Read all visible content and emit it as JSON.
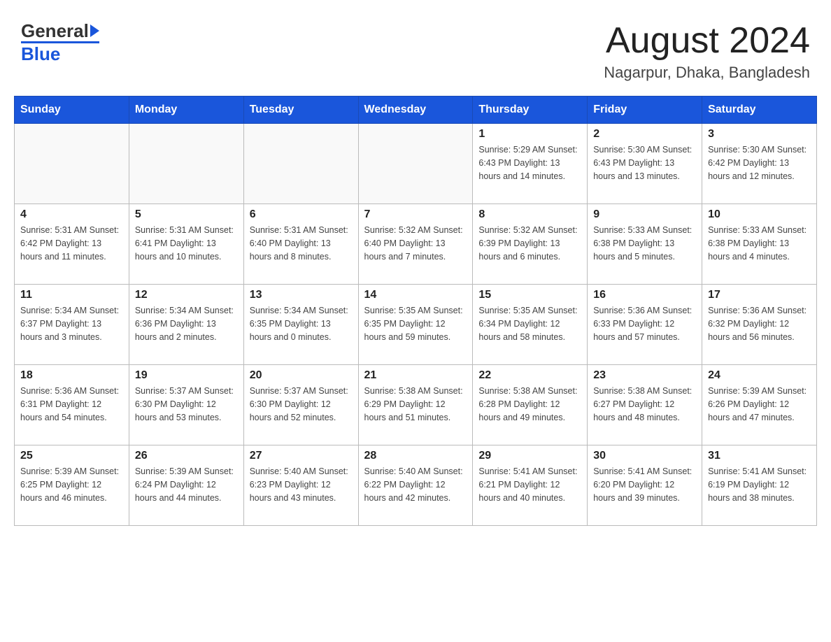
{
  "header": {
    "logo_general": "General",
    "logo_blue": "Blue",
    "month_title": "August 2024",
    "location": "Nagarpur, Dhaka, Bangladesh"
  },
  "days_of_week": [
    "Sunday",
    "Monday",
    "Tuesday",
    "Wednesday",
    "Thursday",
    "Friday",
    "Saturday"
  ],
  "weeks": [
    [
      {
        "day": "",
        "info": ""
      },
      {
        "day": "",
        "info": ""
      },
      {
        "day": "",
        "info": ""
      },
      {
        "day": "",
        "info": ""
      },
      {
        "day": "1",
        "info": "Sunrise: 5:29 AM\nSunset: 6:43 PM\nDaylight: 13 hours\nand 14 minutes."
      },
      {
        "day": "2",
        "info": "Sunrise: 5:30 AM\nSunset: 6:43 PM\nDaylight: 13 hours\nand 13 minutes."
      },
      {
        "day": "3",
        "info": "Sunrise: 5:30 AM\nSunset: 6:42 PM\nDaylight: 13 hours\nand 12 minutes."
      }
    ],
    [
      {
        "day": "4",
        "info": "Sunrise: 5:31 AM\nSunset: 6:42 PM\nDaylight: 13 hours\nand 11 minutes."
      },
      {
        "day": "5",
        "info": "Sunrise: 5:31 AM\nSunset: 6:41 PM\nDaylight: 13 hours\nand 10 minutes."
      },
      {
        "day": "6",
        "info": "Sunrise: 5:31 AM\nSunset: 6:40 PM\nDaylight: 13 hours\nand 8 minutes."
      },
      {
        "day": "7",
        "info": "Sunrise: 5:32 AM\nSunset: 6:40 PM\nDaylight: 13 hours\nand 7 minutes."
      },
      {
        "day": "8",
        "info": "Sunrise: 5:32 AM\nSunset: 6:39 PM\nDaylight: 13 hours\nand 6 minutes."
      },
      {
        "day": "9",
        "info": "Sunrise: 5:33 AM\nSunset: 6:38 PM\nDaylight: 13 hours\nand 5 minutes."
      },
      {
        "day": "10",
        "info": "Sunrise: 5:33 AM\nSunset: 6:38 PM\nDaylight: 13 hours\nand 4 minutes."
      }
    ],
    [
      {
        "day": "11",
        "info": "Sunrise: 5:34 AM\nSunset: 6:37 PM\nDaylight: 13 hours\nand 3 minutes."
      },
      {
        "day": "12",
        "info": "Sunrise: 5:34 AM\nSunset: 6:36 PM\nDaylight: 13 hours\nand 2 minutes."
      },
      {
        "day": "13",
        "info": "Sunrise: 5:34 AM\nSunset: 6:35 PM\nDaylight: 13 hours\nand 0 minutes."
      },
      {
        "day": "14",
        "info": "Sunrise: 5:35 AM\nSunset: 6:35 PM\nDaylight: 12 hours\nand 59 minutes."
      },
      {
        "day": "15",
        "info": "Sunrise: 5:35 AM\nSunset: 6:34 PM\nDaylight: 12 hours\nand 58 minutes."
      },
      {
        "day": "16",
        "info": "Sunrise: 5:36 AM\nSunset: 6:33 PM\nDaylight: 12 hours\nand 57 minutes."
      },
      {
        "day": "17",
        "info": "Sunrise: 5:36 AM\nSunset: 6:32 PM\nDaylight: 12 hours\nand 56 minutes."
      }
    ],
    [
      {
        "day": "18",
        "info": "Sunrise: 5:36 AM\nSunset: 6:31 PM\nDaylight: 12 hours\nand 54 minutes."
      },
      {
        "day": "19",
        "info": "Sunrise: 5:37 AM\nSunset: 6:30 PM\nDaylight: 12 hours\nand 53 minutes."
      },
      {
        "day": "20",
        "info": "Sunrise: 5:37 AM\nSunset: 6:30 PM\nDaylight: 12 hours\nand 52 minutes."
      },
      {
        "day": "21",
        "info": "Sunrise: 5:38 AM\nSunset: 6:29 PM\nDaylight: 12 hours\nand 51 minutes."
      },
      {
        "day": "22",
        "info": "Sunrise: 5:38 AM\nSunset: 6:28 PM\nDaylight: 12 hours\nand 49 minutes."
      },
      {
        "day": "23",
        "info": "Sunrise: 5:38 AM\nSunset: 6:27 PM\nDaylight: 12 hours\nand 48 minutes."
      },
      {
        "day": "24",
        "info": "Sunrise: 5:39 AM\nSunset: 6:26 PM\nDaylight: 12 hours\nand 47 minutes."
      }
    ],
    [
      {
        "day": "25",
        "info": "Sunrise: 5:39 AM\nSunset: 6:25 PM\nDaylight: 12 hours\nand 46 minutes."
      },
      {
        "day": "26",
        "info": "Sunrise: 5:39 AM\nSunset: 6:24 PM\nDaylight: 12 hours\nand 44 minutes."
      },
      {
        "day": "27",
        "info": "Sunrise: 5:40 AM\nSunset: 6:23 PM\nDaylight: 12 hours\nand 43 minutes."
      },
      {
        "day": "28",
        "info": "Sunrise: 5:40 AM\nSunset: 6:22 PM\nDaylight: 12 hours\nand 42 minutes."
      },
      {
        "day": "29",
        "info": "Sunrise: 5:41 AM\nSunset: 6:21 PM\nDaylight: 12 hours\nand 40 minutes."
      },
      {
        "day": "30",
        "info": "Sunrise: 5:41 AM\nSunset: 6:20 PM\nDaylight: 12 hours\nand 39 minutes."
      },
      {
        "day": "31",
        "info": "Sunrise: 5:41 AM\nSunset: 6:19 PM\nDaylight: 12 hours\nand 38 minutes."
      }
    ]
  ]
}
